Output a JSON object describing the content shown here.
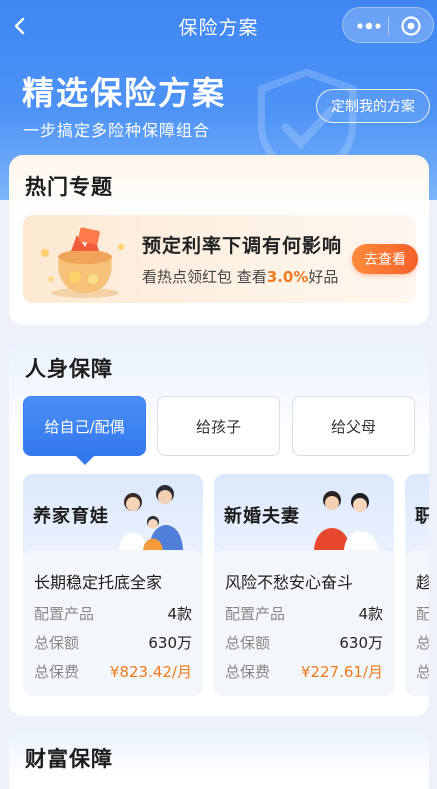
{
  "nav": {
    "title": "保险方案",
    "back_icon": "chevron-left-icon",
    "more_icon": "more-dots-icon",
    "close_icon": "target-circle-icon"
  },
  "hero": {
    "title": "精选保险方案",
    "subtitle": "一步搞定多险种保障组合",
    "custom_button": "定制我的方案"
  },
  "hot": {
    "title": "热门专题",
    "banner": {
      "title": "预定利率下调有何影响",
      "sub_prefix": "看热点领红包 查看",
      "sub_highlight": "3.0%",
      "sub_suffix": "好品",
      "button": "去查看"
    }
  },
  "person": {
    "title": "人身保障",
    "tabs": [
      "给自己/配偶",
      "给孩子",
      "给父母"
    ],
    "active_tab": 0,
    "plans": [
      {
        "name": "养家育娃",
        "slogan": "长期稳定托底全家",
        "rows": [
          {
            "k": "配置产品",
            "v": "4款"
          },
          {
            "k": "总保额",
            "v": "630万"
          },
          {
            "k": "总保费",
            "v": "¥823.42/月"
          }
        ]
      },
      {
        "name": "新婚夫妻",
        "slogan": "风险不愁安心奋斗",
        "rows": [
          {
            "k": "配置产品",
            "v": "4款"
          },
          {
            "k": "总保额",
            "v": "630万"
          },
          {
            "k": "总保费",
            "v": "¥227.61/月"
          }
        ]
      },
      {
        "name": "职",
        "slogan": "趁",
        "rows": [
          {
            "k": "配",
            "v": ""
          },
          {
            "k": "总",
            "v": ""
          },
          {
            "k": "总",
            "v": ""
          }
        ]
      }
    ]
  },
  "wealth": {
    "title": "财富保障"
  },
  "colors": {
    "primary": "#3478ee",
    "accent": "#f07a1e"
  }
}
